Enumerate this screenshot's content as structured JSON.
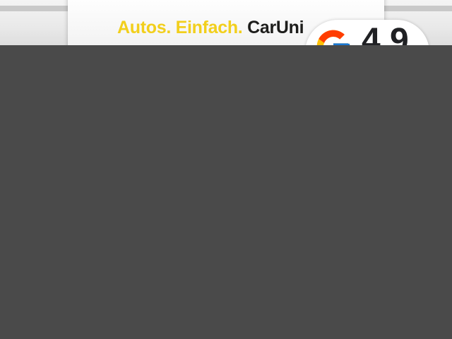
{
  "banner": {
    "slogan_part1": "Autos. Einfach.",
    "slogan_part2": "CarUni",
    "rating_value": "4.9"
  },
  "colors": {
    "accent_yellow": "#f2cf1c",
    "dark_text": "#1d1d1b",
    "overlay": "#4a4a4a"
  },
  "icons": {
    "badge_icon": "google-g-icon"
  }
}
